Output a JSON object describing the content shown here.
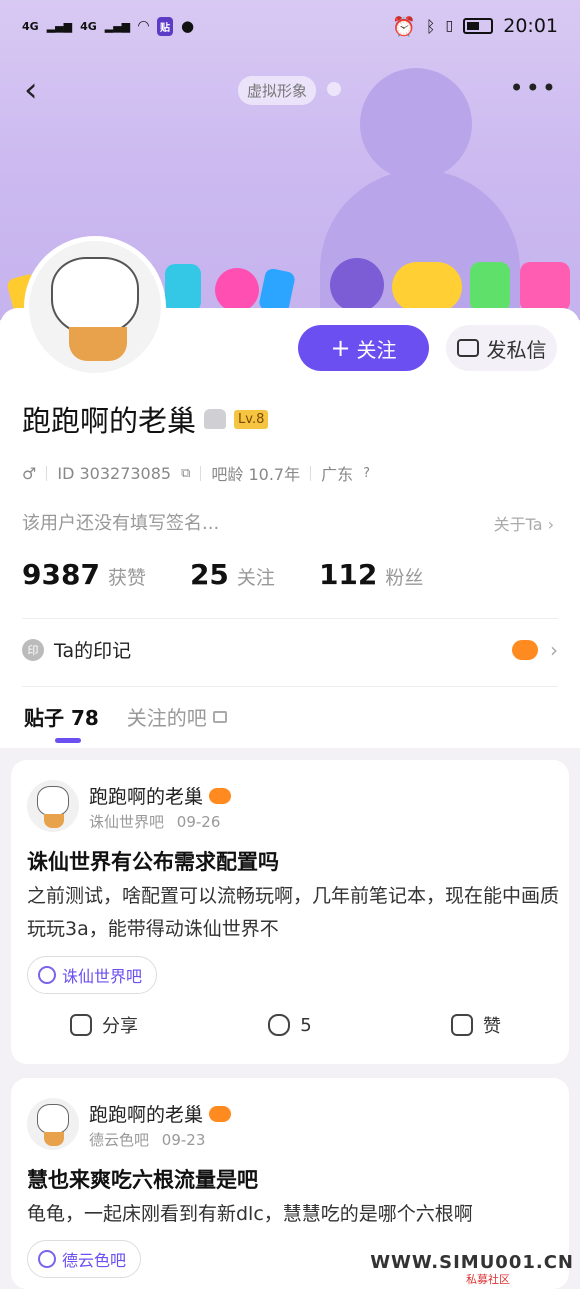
{
  "status_bar": {
    "time": "20:01",
    "network_1": "4G",
    "network_2": "4G",
    "app_chip": "贴"
  },
  "nav": {
    "virtual_tag": "虚拟形象"
  },
  "profile": {
    "follow_label": "关注",
    "dm_label": "发私信",
    "username": "跑跑啊的老巢",
    "level": "Lv.8",
    "id_text": "ID 303273085",
    "age_text": "吧龄 10.7年",
    "location": "广东",
    "signature": "该用户还没有填写签名...",
    "about_label": "关于Ta",
    "stats": [
      {
        "num": "9387",
        "label": "获赞"
      },
      {
        "num": "25",
        "label": "关注"
      },
      {
        "num": "112",
        "label": "粉丝"
      }
    ],
    "mark_icon_text": "印",
    "mark_label": "Ta的印记"
  },
  "tabs": {
    "posts": "贴子 78",
    "followed": "关注的吧"
  },
  "posts": [
    {
      "author": "跑跑啊的老巢",
      "forum": "诛仙世界吧",
      "date": "09-26",
      "title": "诛仙世界有公布需求配置吗",
      "body": "之前测试，啥配置可以流畅玩啊，几年前笔记本，现在能中画质玩玩3a，能带得动诛仙世界不",
      "chip": "诛仙世界吧",
      "share": "分享",
      "comments": "5",
      "like": "赞"
    },
    {
      "author": "跑跑啊的老巢",
      "forum": "德云色吧",
      "date": "09-23",
      "title": "慧也来爽吃六根流量是吧",
      "body": "龟龟，一起床刚看到有新dlc，慧慧吃的是哪个六根啊",
      "chip": "德云色吧"
    }
  ],
  "watermark": {
    "text": "WWW.SIMU001.CN",
    "sub": "私募社区"
  }
}
